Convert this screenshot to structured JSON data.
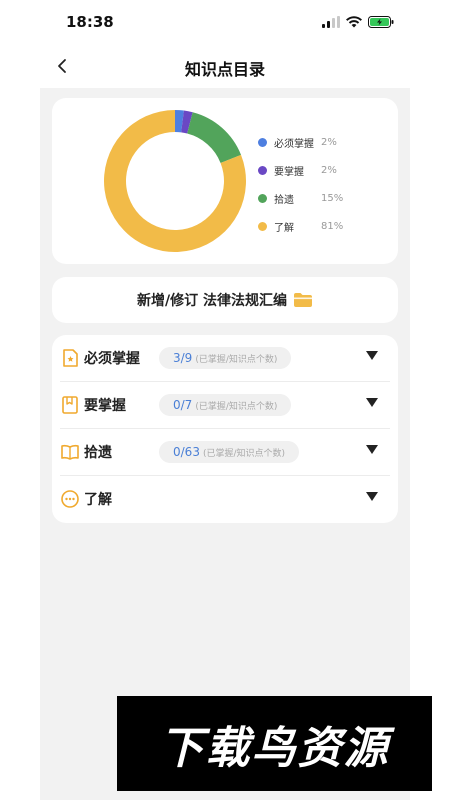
{
  "status": {
    "time": "18:38"
  },
  "nav": {
    "title": "知识点目录"
  },
  "chart_data": {
    "type": "pie",
    "donut": true,
    "categories": [
      "必须掌握",
      "要掌握",
      "拾遗",
      "了解"
    ],
    "values": [
      2,
      2,
      15,
      81
    ],
    "labels": [
      "2%",
      "2%",
      "15%",
      "81%"
    ],
    "colors": [
      "#4e7fe0",
      "#6a48c4",
      "#52a45b",
      "#f2bb48"
    ],
    "legend_position": "right"
  },
  "banner": {
    "text": "新增/修订 法律法规汇编"
  },
  "list": [
    {
      "label": "必须掌握",
      "count": "3/9",
      "hint": "(已掌握/知识点个数)",
      "icon": "star-doc-icon"
    },
    {
      "label": "要掌握",
      "count": "0/7",
      "hint": "(已掌握/知识点个数)",
      "icon": "bookmark-icon"
    },
    {
      "label": "拾遗",
      "count": "0/63",
      "hint": "(已掌握/知识点个数)",
      "icon": "open-book-icon"
    },
    {
      "label": "了解",
      "icon": "more-circle-icon"
    }
  ],
  "watermark": {
    "text": "下载鸟资源"
  },
  "colors": {
    "accent": "#f2bb48",
    "link": "#4a7fd6"
  }
}
